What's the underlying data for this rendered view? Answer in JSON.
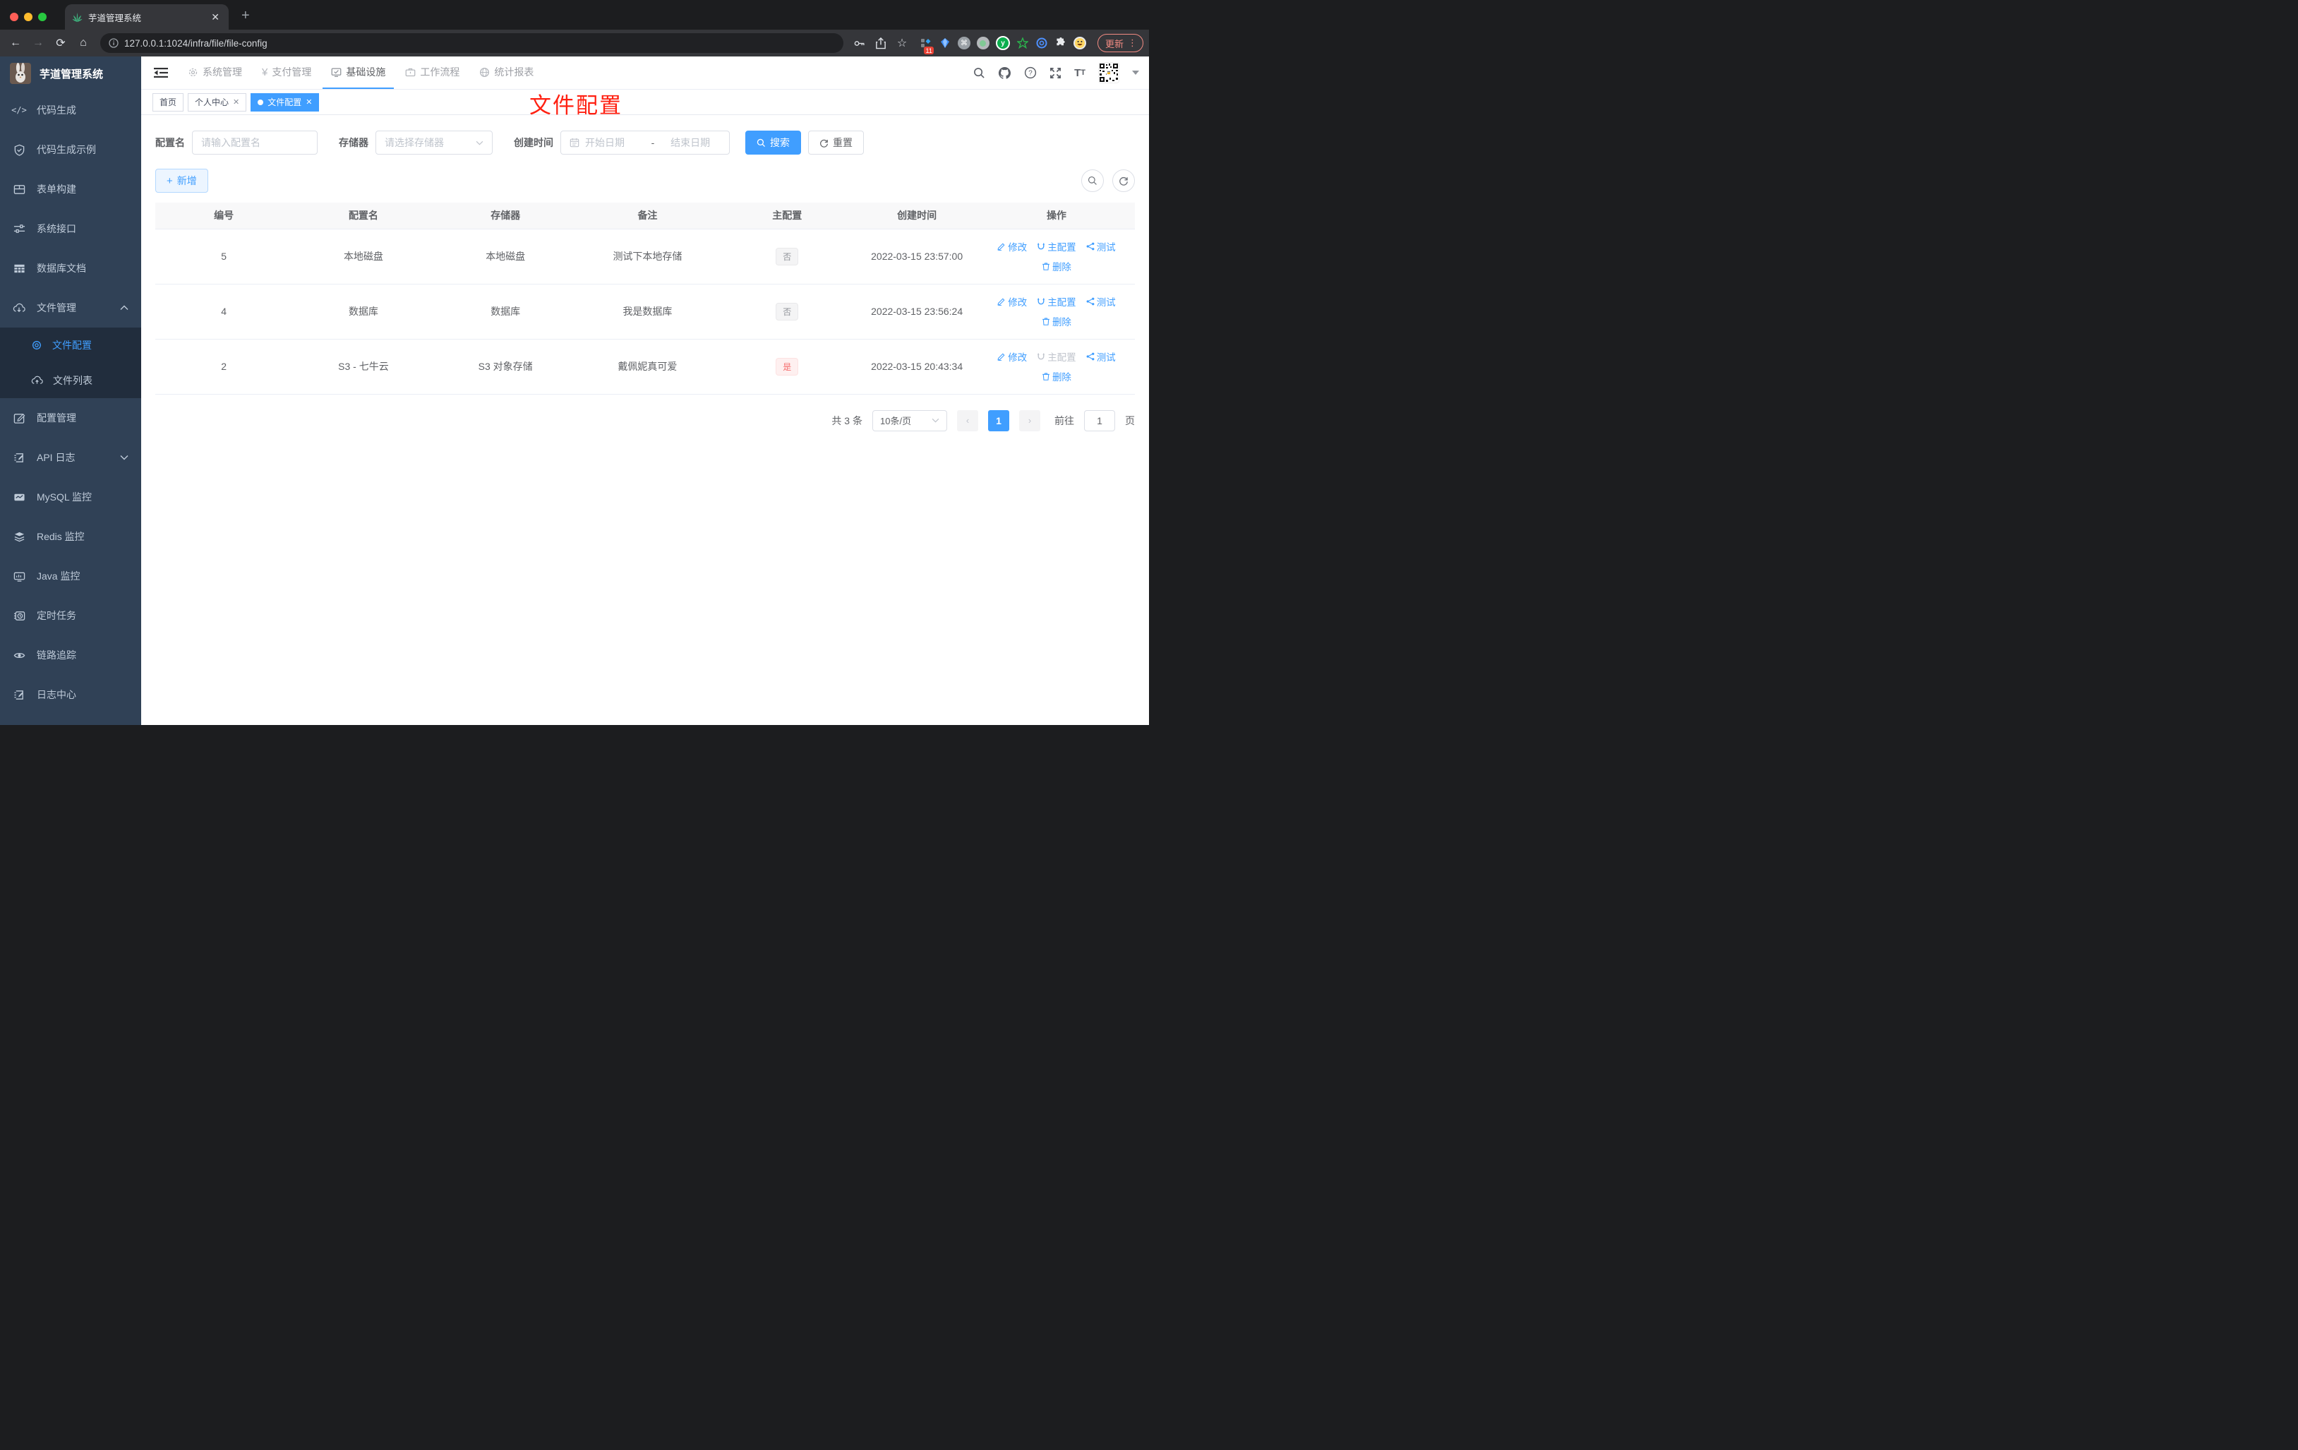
{
  "colors": {
    "accent": "#409eff",
    "sidebar_bg": "#304156",
    "submenu_bg": "#212d3d",
    "danger": "#f56c6c",
    "annotation_red": "#ff2011",
    "update_pill": "#f28b82"
  },
  "browser": {
    "tab_title": "芋道管理系统",
    "url": "127.0.0.1:1024/infra/file/file-config",
    "update_label": "更新",
    "extensions_badge": "11",
    "ext_y_label": "y",
    "ext_cmd_label": "⌘"
  },
  "app": {
    "logo_title": "芋道管理系统",
    "annotation": "文件配置",
    "nav": [
      {
        "label": "系统管理"
      },
      {
        "label": "支付管理"
      },
      {
        "label": "基础设施"
      },
      {
        "label": "工作流程"
      },
      {
        "label": "统计报表"
      }
    ],
    "tags": [
      {
        "label": "首页"
      },
      {
        "label": "个人中心"
      },
      {
        "label": "文件配置"
      }
    ]
  },
  "sidebar": {
    "items": [
      {
        "label": "代码生成"
      },
      {
        "label": "代码生成示例"
      },
      {
        "label": "表单构建"
      },
      {
        "label": "系统接口"
      },
      {
        "label": "数据库文档"
      },
      {
        "label": "文件管理"
      },
      {
        "label": "配置管理"
      },
      {
        "label": "API 日志"
      },
      {
        "label": "MySQL 监控"
      },
      {
        "label": "Redis 监控"
      },
      {
        "label": "Java 监控"
      },
      {
        "label": "定时任务"
      },
      {
        "label": "链路追踪"
      },
      {
        "label": "日志中心"
      }
    ],
    "file_children": [
      {
        "label": "文件配置"
      },
      {
        "label": "文件列表"
      }
    ]
  },
  "filters": {
    "config_name_label": "配置名",
    "config_name_placeholder": "请输入配置名",
    "storage_label": "存储器",
    "storage_placeholder": "请选择存储器",
    "create_time_label": "创建时间",
    "start_placeholder": "开始日期",
    "range_separator": "-",
    "end_placeholder": "结束日期",
    "search_label": "搜索",
    "reset_label": "重置",
    "add_label": "新增"
  },
  "table": {
    "columns": [
      "编号",
      "配置名",
      "存储器",
      "备注",
      "主配置",
      "创建时间",
      "操作"
    ],
    "actions": {
      "edit": "修改",
      "master": "主配置",
      "test": "测试",
      "delete": "删除"
    },
    "rows": [
      {
        "id": "5",
        "name": "本地磁盘",
        "storage": "本地磁盘",
        "remark": "测试下本地存储",
        "master": "否",
        "created": "2022-03-15 23:57:00"
      },
      {
        "id": "4",
        "name": "数据库",
        "storage": "数据库",
        "remark": "我是数据库",
        "master": "否",
        "created": "2022-03-15 23:56:24"
      },
      {
        "id": "2",
        "name": "S3 - 七牛云",
        "storage": "S3 对象存储",
        "remark": "戴佩妮真可爱",
        "master": "是",
        "created": "2022-03-15 20:43:34"
      }
    ]
  },
  "pagination": {
    "total_text": "共 3 条",
    "page_size": "10条/页",
    "prev_label": "‹",
    "current_page": "1",
    "next_label": "›",
    "goto_label": "前往",
    "goto_value": "1",
    "page_unit": "页"
  }
}
